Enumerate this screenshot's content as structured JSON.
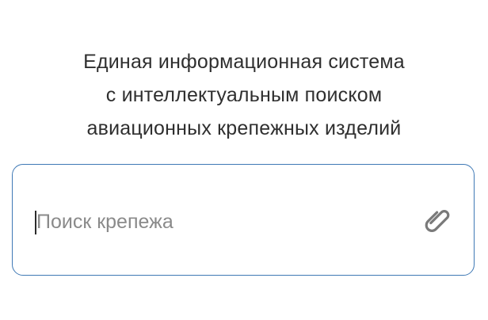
{
  "header": {
    "title_lines": [
      "Единая информационная система",
      "с интеллектуальным поиском",
      "авиационных крепежных изделий"
    ]
  },
  "search": {
    "value": "",
    "placeholder": "Поиск крепежа",
    "attach_icon": "paperclip-icon"
  },
  "colors": {
    "border": "#3f79b5",
    "text": "#2f2f2f",
    "placeholder": "#8a8a8a",
    "icon": "#7a7a7a"
  }
}
